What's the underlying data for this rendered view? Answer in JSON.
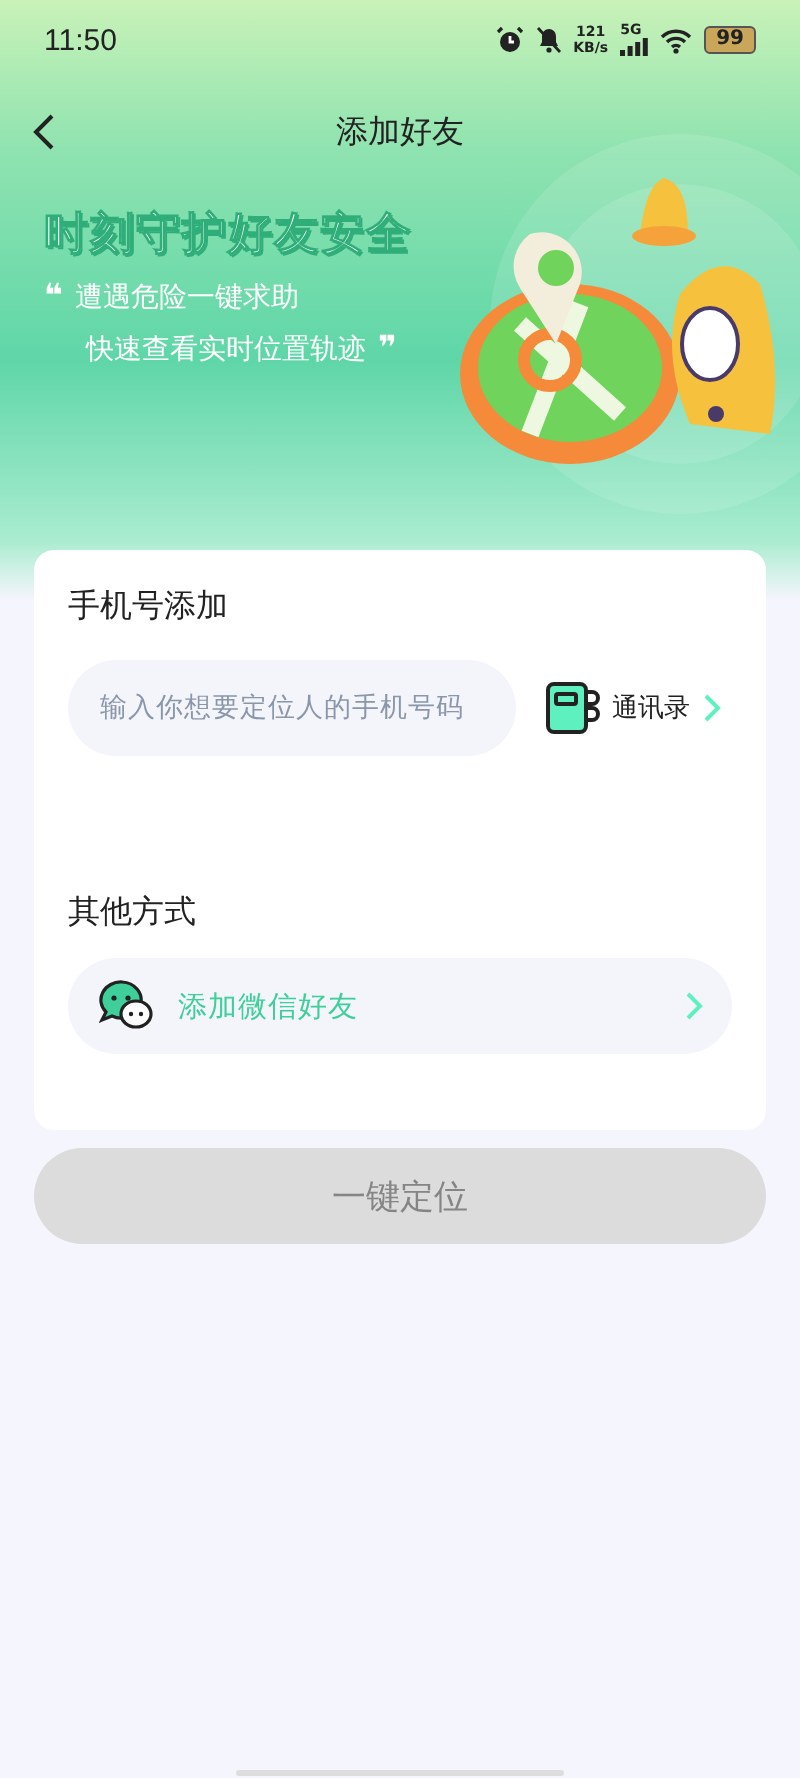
{
  "status_bar": {
    "time": "11:50",
    "net_speed": "121",
    "net_unit": "KB/s",
    "network": "5G",
    "battery": "99"
  },
  "nav": {
    "title": "添加好友"
  },
  "banner": {
    "headline": "时刻守护好友安全",
    "quote_open": "❝",
    "quote_close": "❞",
    "lines": [
      "遭遇危险一键求助",
      "快速查看实时位置轨迹"
    ]
  },
  "phone_section": {
    "title": "手机号添加",
    "placeholder": "输入你想要定位人的手机号码",
    "contacts_label": "通讯录"
  },
  "other_section": {
    "title": "其他方式",
    "options": [
      {
        "label": "添加微信好友"
      }
    ]
  },
  "locate_button": {
    "label": "一键定位",
    "disabled": true
  }
}
